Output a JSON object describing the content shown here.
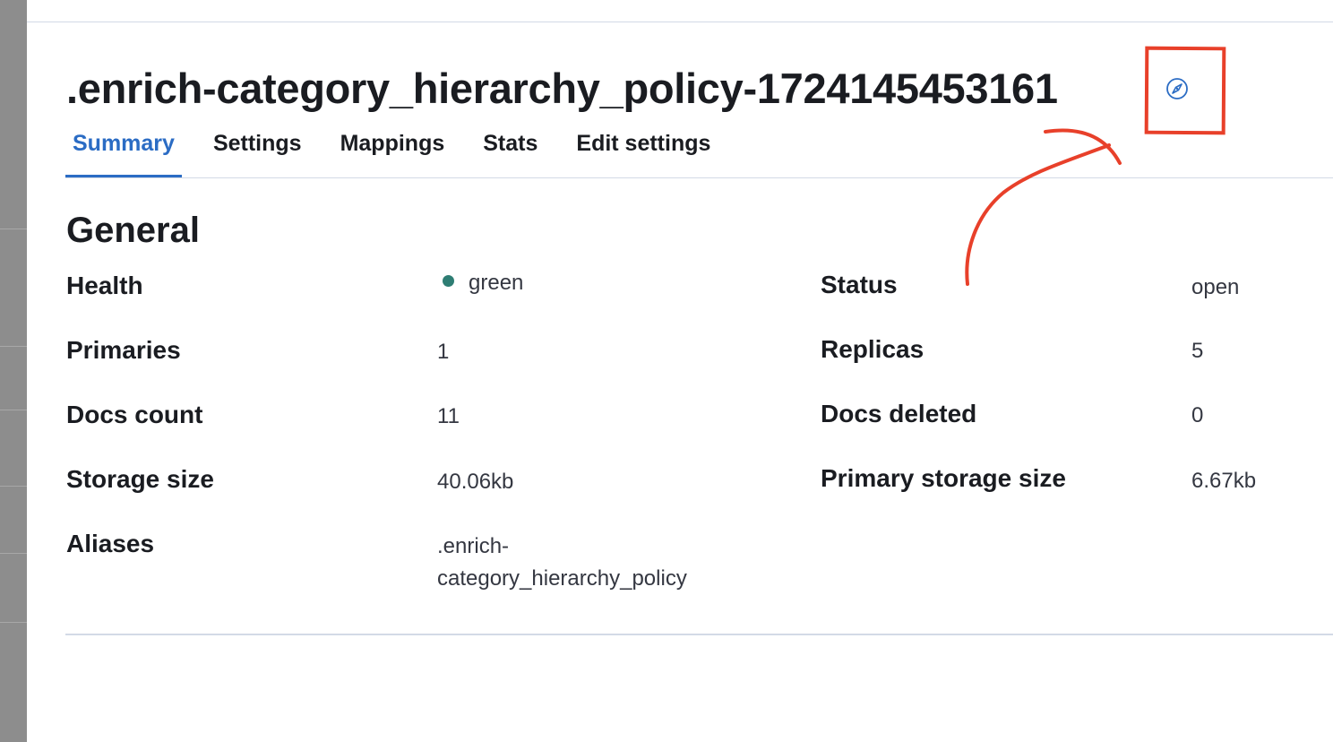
{
  "header": {
    "title": ".enrich-category_hierarchy_policy-1724145453161",
    "discover_icon": "compass-icon"
  },
  "tabs": [
    {
      "label": "Summary",
      "active": true
    },
    {
      "label": "Settings",
      "active": false
    },
    {
      "label": "Mappings",
      "active": false
    },
    {
      "label": "Stats",
      "active": false
    },
    {
      "label": "Edit settings",
      "active": false
    }
  ],
  "general": {
    "title": "General",
    "fields": {
      "health": {
        "label": "Health",
        "value": "green",
        "status_color": "#2e7d73"
      },
      "status": {
        "label": "Status",
        "value": "open"
      },
      "primaries": {
        "label": "Primaries",
        "value": "1"
      },
      "replicas": {
        "label": "Replicas",
        "value": "5"
      },
      "docs_count": {
        "label": "Docs count",
        "value": "11"
      },
      "docs_deleted": {
        "label": "Docs deleted",
        "value": "0"
      },
      "storage_size": {
        "label": "Storage size",
        "value": "40.06kb"
      },
      "primary_storage_size": {
        "label": "Primary storage size",
        "value": "6.67kb"
      },
      "aliases": {
        "label": "Aliases",
        "value_line1": ".enrich-",
        "value_line2": "category_hierarchy_policy"
      }
    }
  },
  "colors": {
    "accent": "#2b6cc4",
    "annotation": "#e8402a",
    "health_green": "#2e7d73"
  }
}
